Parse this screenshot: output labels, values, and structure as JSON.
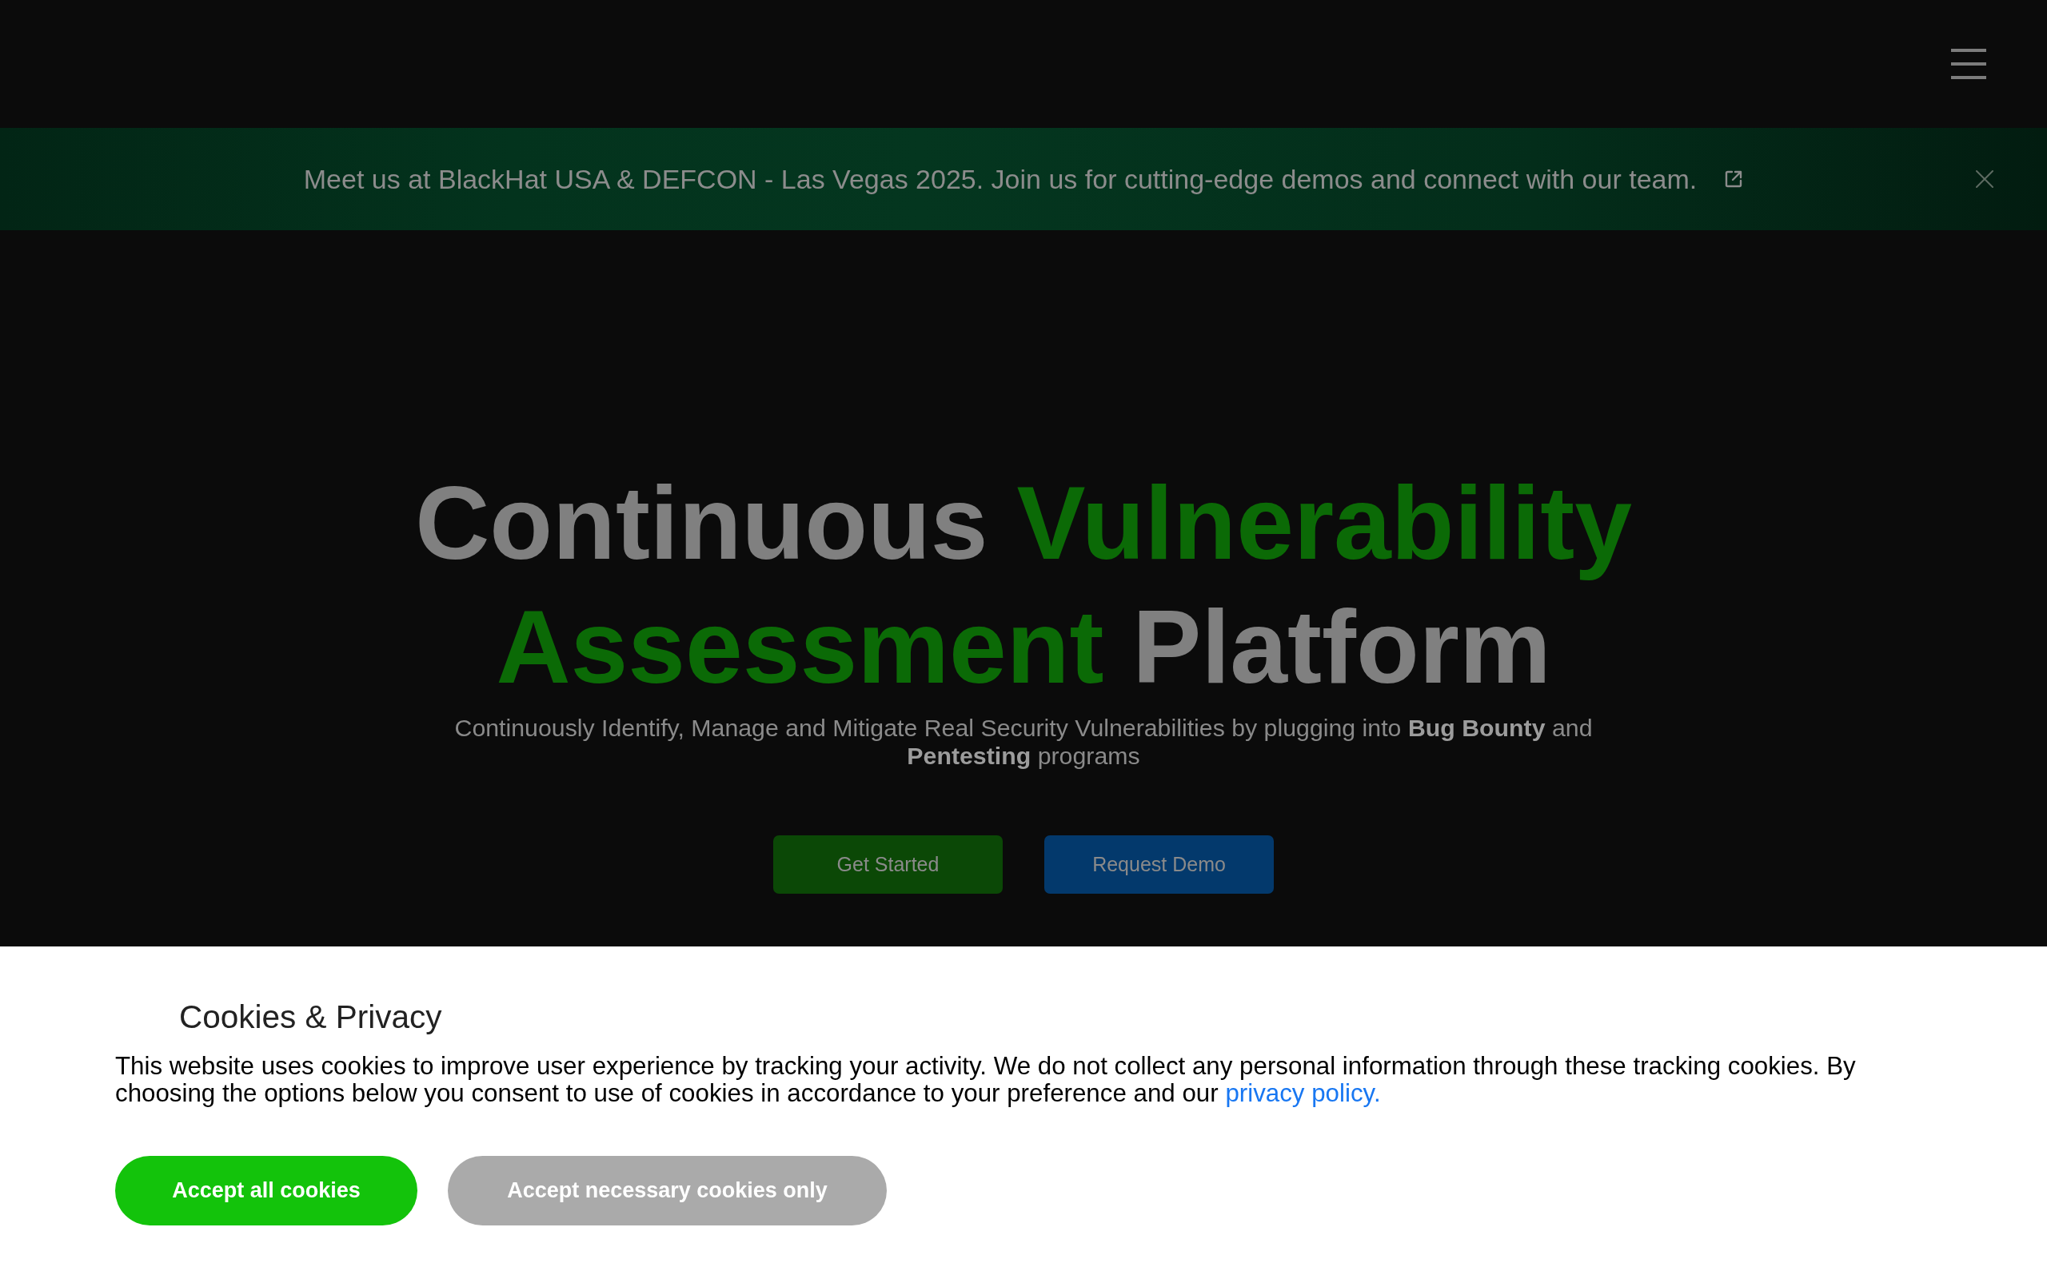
{
  "banner": {
    "text": "Meet us at BlackHat USA & DEFCON - Las Vegas 2025. Join us for cutting-edge demos and connect with our team."
  },
  "hero": {
    "title": [
      {
        "text": "Continuous",
        "accent": false
      },
      {
        "text": "Vulnerability",
        "accent": true
      },
      {
        "text": "Assessment",
        "accent": true
      },
      {
        "text": "Platform",
        "accent": false
      }
    ],
    "subtitle": "Continuously Identify, Manage and Mitigate Real Security Vulnerabilities by plugging into **Bug Bounty** and **Pentesting** programs",
    "buttons": [
      {
        "label": "Get Started",
        "kind": "primary"
      },
      {
        "label": "Request Demo",
        "kind": "secondary"
      }
    ]
  },
  "cookie_panel": {
    "title": "Cookies & Privacy",
    "text": "This website uses cookies to improve user experience by tracking your activity. We do not collect any personal information through these tracking cookies. By choosing the options below you consent to use of cookies in accordance to your preference and our ",
    "link": "privacy policy.",
    "buttons": [
      {
        "label": "Accept all cookies",
        "kind": "accept"
      },
      {
        "label": "Accept necessary cookies only",
        "kind": "necessary"
      }
    ]
  }
}
